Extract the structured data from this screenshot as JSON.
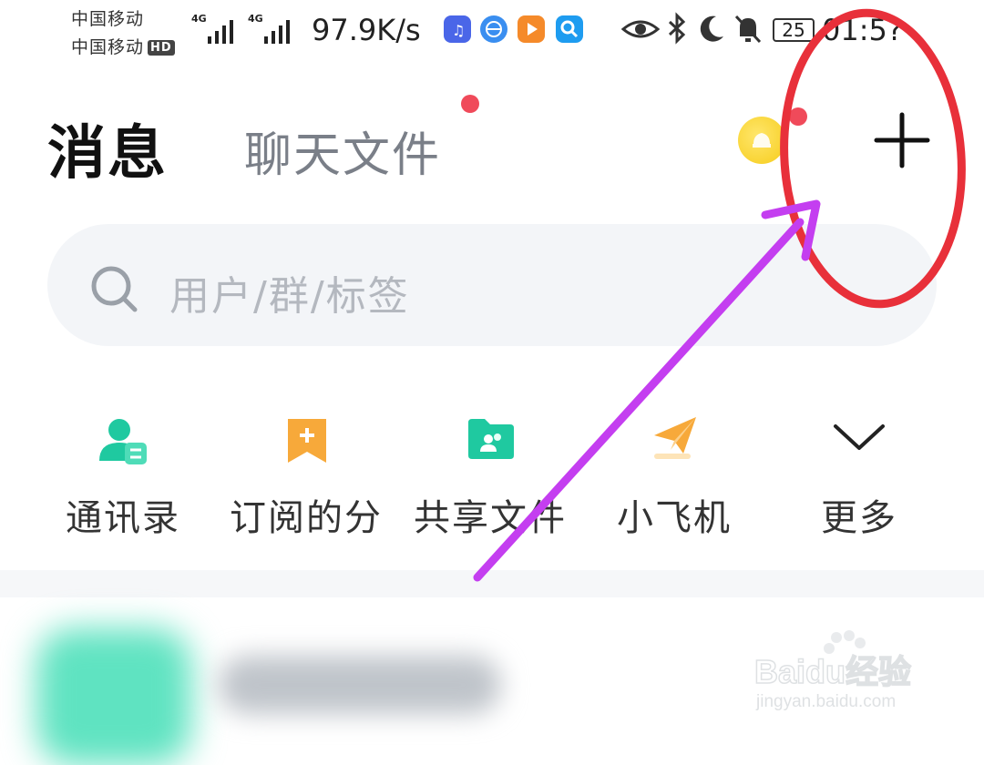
{
  "status_bar": {
    "carrier1": "中国移动",
    "carrier2": "中国移动",
    "hd_badge": "HD",
    "net1": "4G",
    "net2": "4G",
    "speed": "97.9K/s",
    "battery": "25",
    "time": "01:5?"
  },
  "header": {
    "title": "消息",
    "tab_files": "聊天文件"
  },
  "search": {
    "placeholder": "用户/群/标签"
  },
  "shortcuts": [
    {
      "label": "通讯录",
      "icon": "contacts-icon"
    },
    {
      "label": "订阅的分",
      "icon": "subscription-icon"
    },
    {
      "label": "共享文件",
      "icon": "shared-folder-icon"
    },
    {
      "label": "小飞机",
      "icon": "paper-plane-icon"
    },
    {
      "label": "更多",
      "icon": "chevron-down-icon"
    }
  ],
  "watermark": {
    "brand": "Baidu经验",
    "url": "jingyan.baidu.com"
  },
  "colors": {
    "accent_green": "#1fc9a0",
    "accent_orange": "#f7a93a",
    "annotation_red": "#e8303a",
    "annotation_purple": "#c43ef0"
  }
}
